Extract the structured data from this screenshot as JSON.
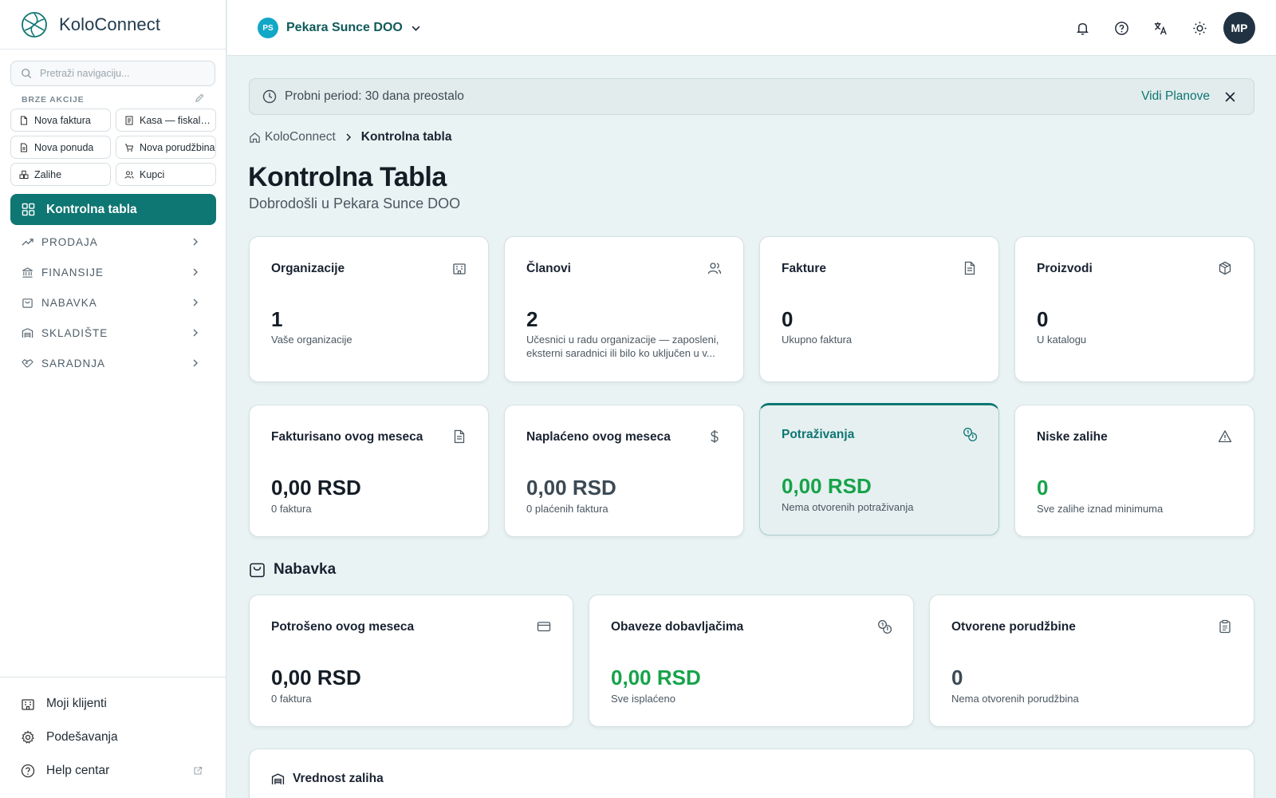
{
  "app": {
    "name": "KoloConnect"
  },
  "sidebar": {
    "search_placeholder": "Pretraži navigaciju...",
    "quick_actions_title": "BRZE AKCIJE",
    "quick_actions": [
      {
        "label": "Nova faktura",
        "icon": "file-icon"
      },
      {
        "label": "Kasa — fiskalni račun",
        "icon": "receipt-icon"
      },
      {
        "label": "Nova ponuda",
        "icon": "file-text-icon"
      },
      {
        "label": "Nova porudžbina",
        "icon": "cart-icon"
      },
      {
        "label": "Zalihe",
        "icon": "boxes-icon"
      },
      {
        "label": "Kupci",
        "icon": "users-icon"
      }
    ],
    "active_item": {
      "label": "Kontrolna tabla",
      "icon": "dashboard-icon"
    },
    "sections": [
      {
        "label": "PRODAJA",
        "icon": "trending-up-icon"
      },
      {
        "label": "FINANSIJE",
        "icon": "bank-icon"
      },
      {
        "label": "NABAVKA",
        "icon": "shopping-bag-icon"
      },
      {
        "label": "SKLADIŠTE",
        "icon": "warehouse-icon"
      },
      {
        "label": "SARADNJA",
        "icon": "handshake-icon"
      }
    ],
    "bottom_links": [
      {
        "label": "Moji klijenti",
        "icon": "building-icon"
      },
      {
        "label": "Podešavanja",
        "icon": "gear-icon"
      },
      {
        "label": "Help centar",
        "icon": "help-circle-icon",
        "external": true
      }
    ]
  },
  "header": {
    "org_initials": "PS",
    "org_name": "Pekara Sunce DOO",
    "user_initials": "MP",
    "icons": [
      "bell-icon",
      "help-icon",
      "translate-icon",
      "sun-icon"
    ]
  },
  "trial": {
    "message": "Probni period: 30 dana preostalo",
    "link": "Vidi Planove"
  },
  "breadcrumb": {
    "root": "KoloConnect",
    "current": "Kontrolna tabla"
  },
  "page": {
    "title": "Kontrolna Tabla",
    "subtitle": "Dobrodošli u Pekara Sunce DOO"
  },
  "stats_row1": [
    {
      "title": "Organizacije",
      "value": "1",
      "desc": "Vaše organizacije",
      "icon": "building-icon"
    },
    {
      "title": "Članovi",
      "value": "2",
      "desc": "Učesnici u radu organizacije — zaposleni, eksterni saradnici ili bilo ko uključen u v...",
      "icon": "users-icon"
    },
    {
      "title": "Fakture",
      "value": "0",
      "desc": "Ukupno faktura",
      "icon": "file-text-icon"
    },
    {
      "title": "Proizvodi",
      "value": "0",
      "desc": "U katalogu",
      "icon": "package-icon"
    }
  ],
  "stats_row2": [
    {
      "title": "Fakturisano ovog meseca",
      "value": "0,00 RSD",
      "desc": "0 faktura",
      "icon": "file-text-icon"
    },
    {
      "title": "Naplaćeno ovog meseca",
      "value": "0,00 RSD",
      "desc": "0 plaćenih faktura",
      "icon": "dollar-icon"
    },
    {
      "title": "Potraživanja",
      "value": "0,00 RSD",
      "desc": "Nema otvorenih potraživanja",
      "icon": "coins-icon"
    },
    {
      "title": "Niske zalihe",
      "value": "0",
      "desc": "Sve zalihe iznad minimuma",
      "icon": "warning-icon"
    }
  ],
  "procurement": {
    "title": "Nabavka",
    "cards": [
      {
        "title": "Potrošeno ovog meseca",
        "value": "0,00 RSD",
        "desc": "0 faktura",
        "icon": "credit-card-icon"
      },
      {
        "title": "Obaveze dobavljačima",
        "value": "0,00 RSD",
        "desc": "Sve isplaćeno",
        "icon": "coins-icon"
      },
      {
        "title": "Otvorene porudžbine",
        "value": "0",
        "desc": "Nema otvorenih porudžbina",
        "icon": "clipboard-icon"
      }
    ]
  },
  "inventory_value": {
    "title": "Vrednost zaliha"
  },
  "colors": {
    "accent": "#0e7673",
    "positive": "#16a34a",
    "background": "#eaf3f3"
  }
}
